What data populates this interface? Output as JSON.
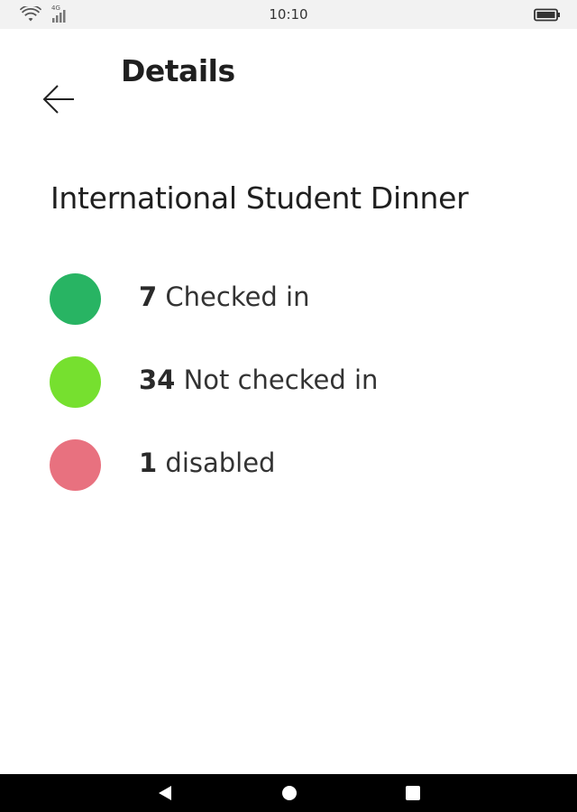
{
  "status_bar": {
    "time": "10:10",
    "signal_label": "4G",
    "icons": [
      "wifi-icon",
      "signal-icon",
      "battery-icon"
    ]
  },
  "header": {
    "title": "Details",
    "back_icon": "arrow-left-icon"
  },
  "event": {
    "name": "International Student Dinner"
  },
  "legend": [
    {
      "count": "7",
      "label": " Checked in",
      "color": "#28b463"
    },
    {
      "count": "34",
      "label": " Not checked in",
      "color": "#76e02f"
    },
    {
      "count": "1",
      "label": " disabled",
      "color": "#e8717f"
    }
  ],
  "nav_bar": {
    "icons": [
      "nav-back-icon",
      "nav-home-icon",
      "nav-recents-icon"
    ]
  }
}
